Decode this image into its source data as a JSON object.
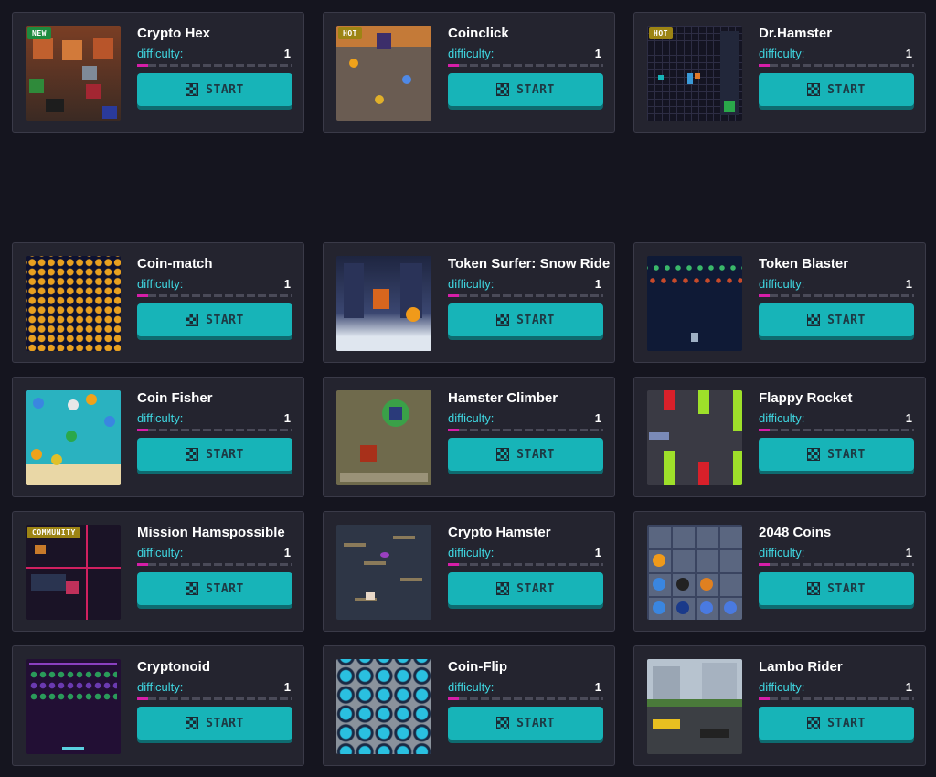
{
  "labels": {
    "difficulty": "difficulty:",
    "start": "START"
  },
  "colors": {
    "accent": "#17b4b8",
    "difficulty_text": "#3fd6e0",
    "bar_fill": "#d61ea8",
    "badge_new": "#1e8a3e",
    "badge_hot": "#9c8414"
  },
  "games": [
    {
      "title": "Crypto Hex",
      "difficulty": "1",
      "badge": "NEW",
      "thumb_icon": "crypto-hex-thumbnail"
    },
    {
      "title": "Coinclick",
      "difficulty": "1",
      "badge": "HOT",
      "thumb_icon": "coinclick-thumbnail"
    },
    {
      "title": "Dr.Hamster",
      "difficulty": "1",
      "badge": "HOT",
      "thumb_icon": "dr-hamster-thumbnail"
    },
    {
      "title": "Coin-match",
      "difficulty": "1",
      "badge": "",
      "thumb_icon": "coin-match-thumbnail"
    },
    {
      "title": "Token Surfer: Snow Ride",
      "difficulty": "1",
      "badge": "",
      "thumb_icon": "token-surfer-thumbnail"
    },
    {
      "title": "Token Blaster",
      "difficulty": "1",
      "badge": "",
      "thumb_icon": "token-blaster-thumbnail"
    },
    {
      "title": "Coin Fisher",
      "difficulty": "1",
      "badge": "",
      "thumb_icon": "coin-fisher-thumbnail"
    },
    {
      "title": "Hamster Climber",
      "difficulty": "1",
      "badge": "",
      "thumb_icon": "hamster-climber-thumbnail"
    },
    {
      "title": "Flappy Rocket",
      "difficulty": "1",
      "badge": "",
      "thumb_icon": "flappy-rocket-thumbnail"
    },
    {
      "title": "Mission Hamspossible",
      "difficulty": "1",
      "badge": "COMMUNITY",
      "thumb_icon": "mission-hamspossible-thumbnail"
    },
    {
      "title": "Crypto Hamster",
      "difficulty": "1",
      "badge": "",
      "thumb_icon": "crypto-hamster-thumbnail"
    },
    {
      "title": "2048 Coins",
      "difficulty": "1",
      "badge": "",
      "thumb_icon": "2048-coins-thumbnail"
    },
    {
      "title": "Cryptonoid",
      "difficulty": "1",
      "badge": "",
      "thumb_icon": "cryptonoid-thumbnail"
    },
    {
      "title": "Coin-Flip",
      "difficulty": "1",
      "badge": "",
      "thumb_icon": "coin-flip-thumbnail"
    },
    {
      "title": "Lambo Rider",
      "difficulty": "1",
      "badge": "",
      "thumb_icon": "lambo-rider-thumbnail"
    }
  ]
}
